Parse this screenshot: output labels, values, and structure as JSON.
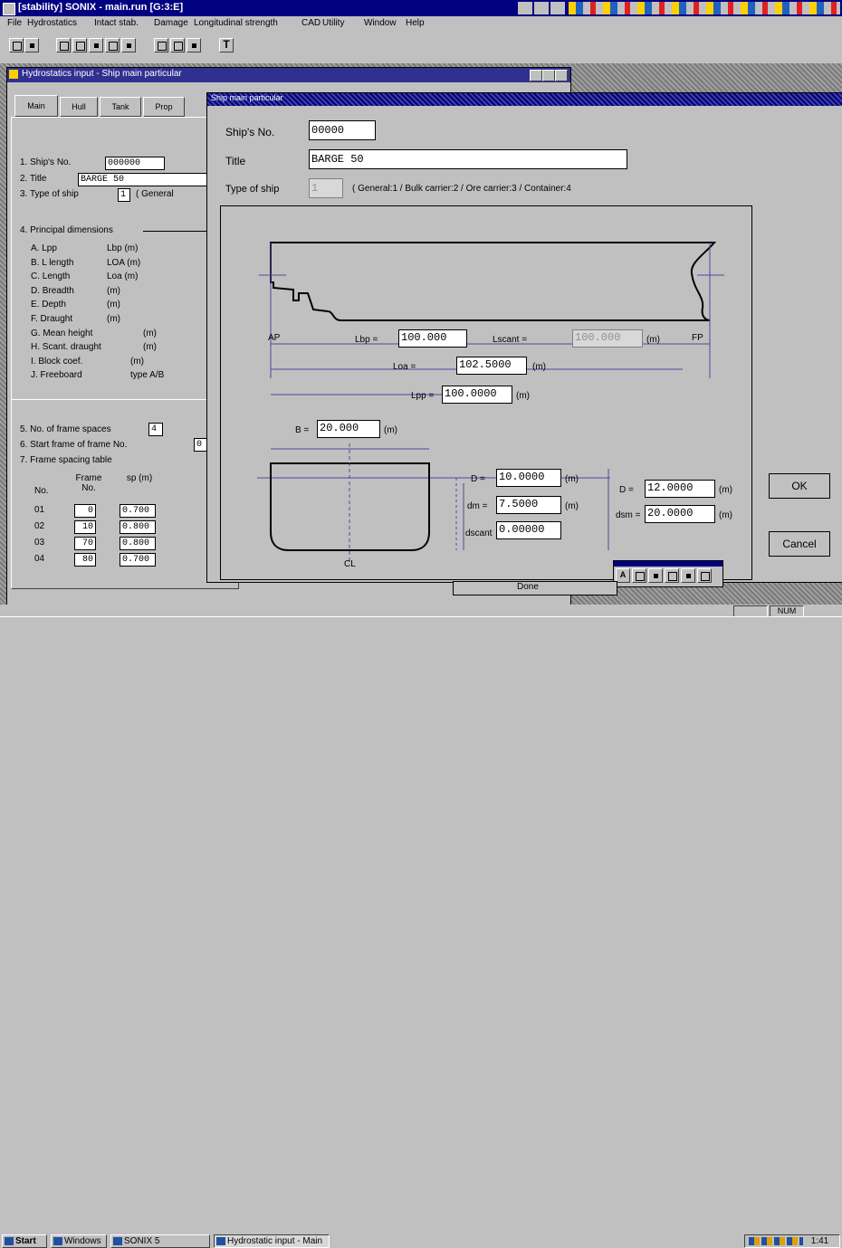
{
  "app": {
    "title": "[stability] SONIX - main.run [G:3:E]",
    "menu": [
      "File",
      "Hydrostatics",
      "Intact stab.",
      "Damage",
      "Longitudinal strength",
      "CAD",
      "Utility",
      "Window",
      "Help"
    ],
    "window_title": "Hydrostatics input - Ship main particular"
  },
  "left_panel": {
    "tabs": [
      "Main",
      "Hull",
      "Tank",
      "Prop"
    ],
    "ship_no_label": "1. Ship's No.",
    "ship_no_value": "000000",
    "title_label": "2. Title",
    "title_value": "BARGE 50",
    "type_label": "3. Type of ship",
    "type_value": "1",
    "type_hint": "( General",
    "particulars_header": "4. Principal dimensions",
    "particulars": [
      {
        "key": "A. Lpp",
        "desc": "Lbp (m)"
      },
      {
        "key": "B. L length",
        "desc": "LOA (m)"
      },
      {
        "key": "C. Length",
        "desc": "Loa (m)"
      },
      {
        "key": "D. Breadth",
        "desc": "(m)"
      },
      {
        "key": "E. Depth",
        "desc": "(m)"
      },
      {
        "key": "F. Draught",
        "desc": "(m)"
      },
      {
        "key": "G. Mean height",
        "desc": "(m)"
      },
      {
        "key": "H. Scant. draught",
        "desc": "(m)"
      },
      {
        "key": "I. Block coef.",
        "desc": "(m)"
      },
      {
        "key": "J. Freeboard",
        "desc": "type A/B"
      }
    ],
    "frame_no_label": "5. No. of frame spaces",
    "frame_no_value": "4",
    "frame_start_label": "6. Start frame of frame No.",
    "frame_start_value": "0",
    "frame_table_header": "7. Frame spacing table",
    "frame_cols": [
      "No.",
      "Frame No.",
      "sp (m)"
    ],
    "frame_rows": [
      {
        "no": "01",
        "frame": "0",
        "sp": "0.700"
      },
      {
        "no": "02",
        "frame": "10",
        "sp": "0.800"
      },
      {
        "no": "03",
        "frame": "70",
        "sp": "0.800"
      },
      {
        "no": "04",
        "frame": "80",
        "sp": "0.700"
      }
    ]
  },
  "dialog": {
    "title": "Ship main particular",
    "ship_no_label": "Ship's No.",
    "ship_no_value": "00000",
    "title_label": "Title",
    "title_value": "BARGE 50",
    "type_label": "Type of ship",
    "type_value": "1",
    "type_hint": "( General:1 / Bulk carrier:2 / Ore carrier:3 / Container:4",
    "diagram": {
      "ap_label": "AP",
      "fp_label": "FP",
      "lbp_label": "Lbp =",
      "lbp_value": "100.000",
      "lbp_unit": "(m)",
      "lscant_label": "Lscant =",
      "lscant_value": "100.000",
      "loa_label": "Loa =",
      "loa_value": "102.5000",
      "loa_unit": "(m)",
      "lpp_label": "Lpp =",
      "lpp_value": "100.0000",
      "lpp_unit": "(m)",
      "b_label": "B =",
      "b_value": "20.000",
      "b_unit": "(m)",
      "d_label": "D =",
      "d_value": "10.0000",
      "d_unit": "(m)",
      "dm_label": "dm =",
      "dm_value": "7.5000",
      "dm_unit": "(m)",
      "dscant_label": "dscant",
      "dscant_value": "0.00000",
      "ds_label": "D =",
      "ds_value": "12.0000",
      "ds_unit": "(m)",
      "dsm_label": "dsm =",
      "dsm_value": "20.0000",
      "dsm_unit": "(m)",
      "cl_label": "CL"
    },
    "ok_label": "OK",
    "cancel_label": "Cancel"
  },
  "status": {
    "mini_label": "Done",
    "indicator": "NUM"
  },
  "taskbar": {
    "start_label": "Start",
    "tasks": [
      "Windows",
      "SONIX 5",
      "Hydrostatic input - Main"
    ],
    "clock": "1:41"
  }
}
